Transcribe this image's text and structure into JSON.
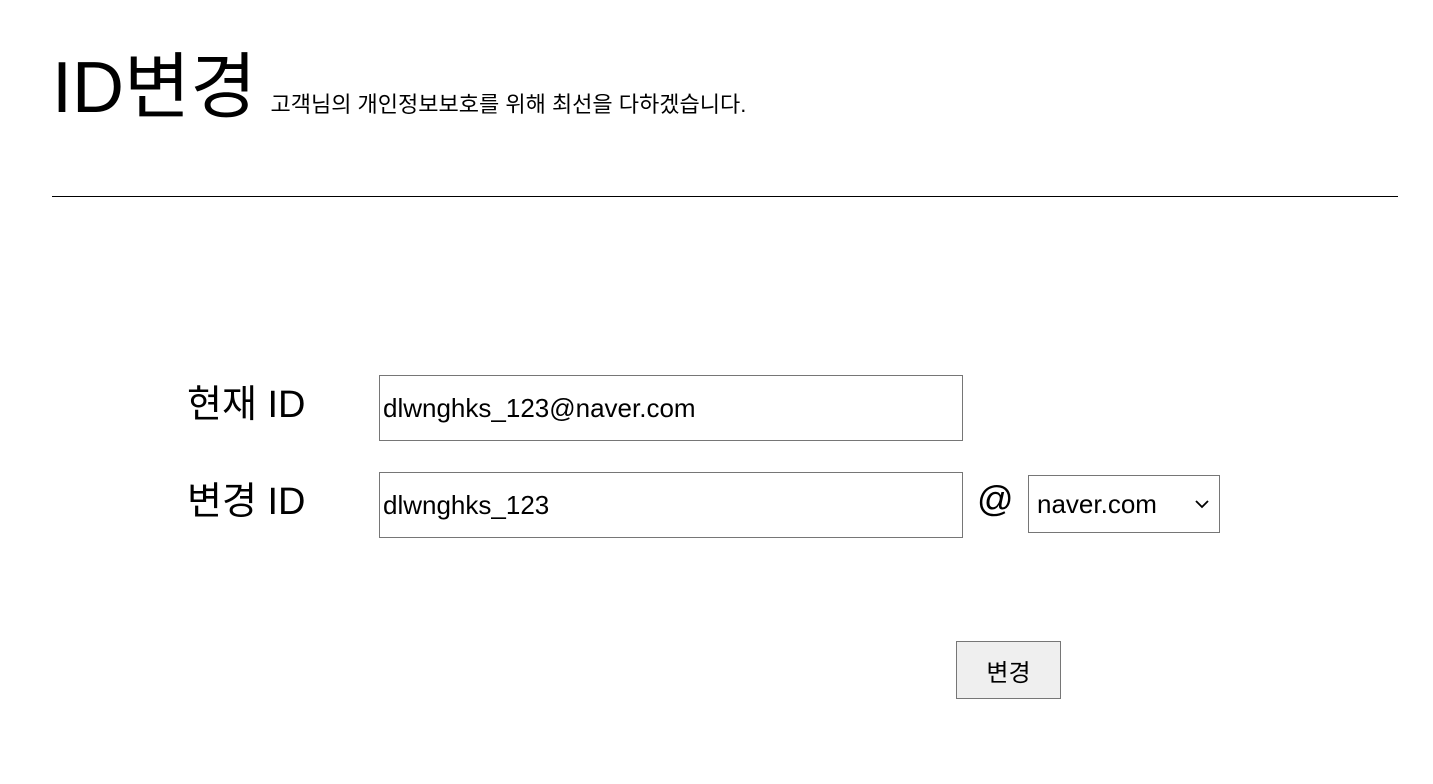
{
  "header": {
    "title": "ID변경",
    "subtitle": "고객님의 개인정보보호를 위해 최선을 다하겠습니다."
  },
  "form": {
    "current_id": {
      "label": "현재 ID",
      "value": "dlwnghks_123@naver.com"
    },
    "new_id": {
      "label": "변경 ID",
      "value": "dlwnghks_123",
      "at_symbol": "@",
      "domain_selected": "naver.com"
    },
    "submit_label": "변경"
  },
  "icons": {
    "dropdown": "chevron-down-icon"
  }
}
